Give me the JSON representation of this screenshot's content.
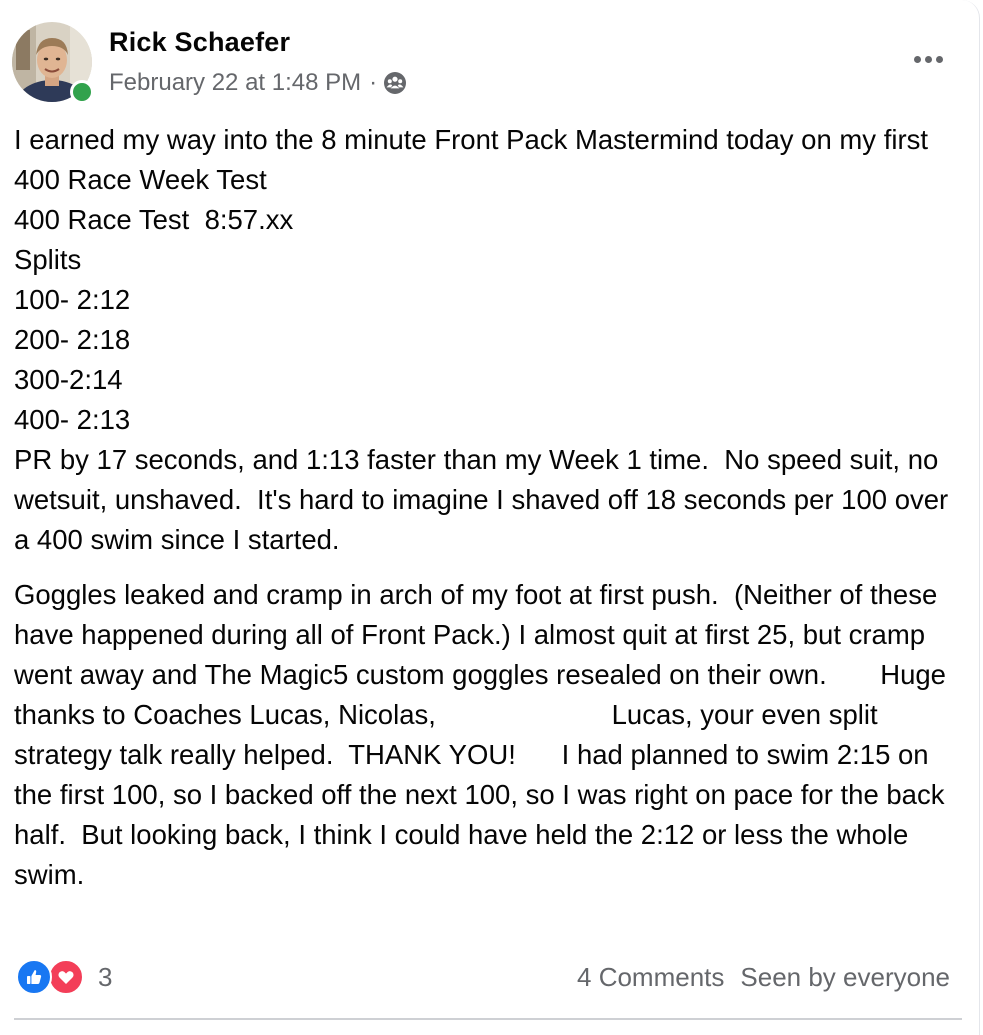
{
  "post": {
    "author": "Rick Schaefer",
    "timestamp": "February 22 at 1:48 PM",
    "separator": "·",
    "audience_icon": "group-icon",
    "more_icon": "more-horizontal-icon",
    "online": true,
    "paragraphs": [
      "I earned my way into the 8 minute Front Pack Mastermind today on my first 400 Race Week Test\n400 Race Test  8:57.xx\nSplits\n100- 2:12\n200- 2:18\n300-2:14\n400- 2:13\nPR by 17 seconds, and 1:13 faster than my Week 1 time.  No speed suit, no wetsuit, unshaved.  It's hard to imagine I shaved off 18 seconds per 100 over a 400 swim since I started.",
      "Goggles leaked and cramp in arch of my foot at first push.  (Neither of these have happened during all of Front Pack.) I almost quit at first 25, but cramp went away and The Magic5 custom goggles resealed on their own.       Huge thanks to Coaches Lucas, Nicolas,                       Lucas, your even split strategy talk really helped.  THANK YOU!      I had planned to swim 2:15 on the first 100, so I backed off the next 100, so I was right on pace for the back half.  But looking back, I think I could have held the 2:12 or less the whole swim."
    ]
  },
  "footer": {
    "reactions": [
      "like-icon",
      "love-icon"
    ],
    "reaction_count": "3",
    "comments": "4 Comments",
    "seen_by": "Seen by everyone"
  },
  "colors": {
    "text_primary": "#050505",
    "text_secondary": "#65676b",
    "like_blue": "#1877f2",
    "love_red": "#f33e58",
    "online_green": "#31a24c"
  }
}
